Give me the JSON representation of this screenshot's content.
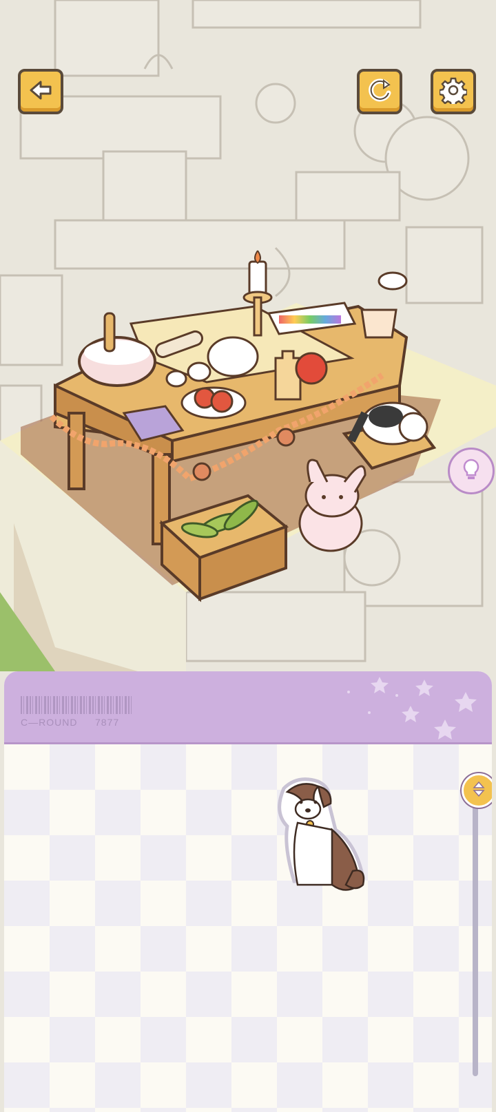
{
  "panel": {
    "code_label": "C—ROUND",
    "code_number": "7877"
  },
  "icons": {
    "back": "arrow-left-icon",
    "refresh": "refresh-icon",
    "settings": "gear-icon",
    "hint": "lightbulb-icon",
    "scroll": "up-down-arrows-icon"
  },
  "colors": {
    "button_fill": "#f3c24f",
    "panel_header": "#cdb0de",
    "hint_ring": "#b98bc7"
  }
}
